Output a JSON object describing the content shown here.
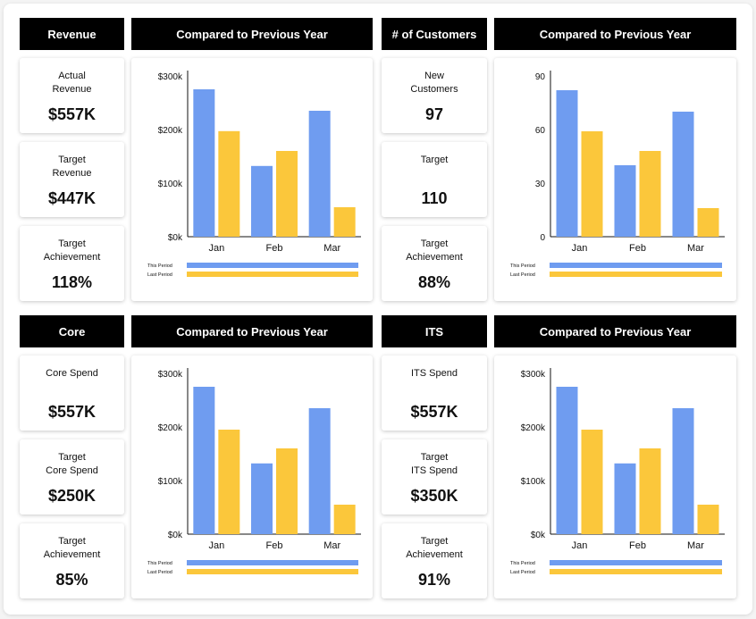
{
  "colors": {
    "this_period": "#6f9cf0",
    "last_period": "#fbc73b",
    "header_bg": "#000000"
  },
  "sections": [
    {
      "header": "Revenue",
      "chart_header": "Compared to Previous Year",
      "kpis": [
        {
          "label": "Actual\nRevenue",
          "value": "$557K"
        },
        {
          "label": "Target\nRevenue",
          "value": "$447K"
        },
        {
          "label": "Target\nAchievement",
          "value": "118%"
        }
      ]
    },
    {
      "header": "# of Customers",
      "chart_header": "Compared to Previous Year",
      "kpis": [
        {
          "label": "New\nCustomers",
          "value": "97"
        },
        {
          "label": "Target",
          "value": "110"
        },
        {
          "label": "Target\nAchievement",
          "value": "88%"
        }
      ]
    },
    {
      "header": "Core",
      "chart_header": "Compared to Previous Year",
      "kpis": [
        {
          "label": "Core Spend",
          "value": "$557K"
        },
        {
          "label": "Target\nCore Spend",
          "value": "$250K"
        },
        {
          "label": "Target\nAchievement",
          "value": "85%"
        }
      ]
    },
    {
      "header": "ITS",
      "chart_header": "Compared to Previous Year",
      "kpis": [
        {
          "label": "ITS Spend",
          "value": "$557K"
        },
        {
          "label": "Target\nITS Spend",
          "value": "$350K"
        },
        {
          "label": "Target\nAchievement",
          "value": "91%"
        }
      ]
    }
  ],
  "chart_data": [
    {
      "type": "bar",
      "categories": [
        "Jan",
        "Feb",
        "Mar"
      ],
      "series": [
        {
          "name": "This Period",
          "values": [
            275,
            132,
            235
          ]
        },
        {
          "name": "Last Period",
          "values": [
            197,
            160,
            55
          ]
        }
      ],
      "ylim": [
        0,
        300
      ],
      "ytick_values": [
        0,
        100,
        200,
        300
      ],
      "ytick_labels": [
        "$0k",
        "$100k",
        "$200k",
        "$300k"
      ]
    },
    {
      "type": "bar",
      "categories": [
        "Jan",
        "Feb",
        "Mar"
      ],
      "series": [
        {
          "name": "This Period",
          "values": [
            82,
            40,
            70
          ]
        },
        {
          "name": "Last Period",
          "values": [
            59,
            48,
            16
          ]
        }
      ],
      "ylim": [
        0,
        90
      ],
      "ytick_values": [
        0,
        30,
        60,
        90
      ],
      "ytick_labels": [
        "0",
        "30",
        "60",
        "90"
      ]
    },
    {
      "type": "bar",
      "categories": [
        "Jan",
        "Feb",
        "Mar"
      ],
      "series": [
        {
          "name": "This Period",
          "values": [
            275,
            132,
            235
          ]
        },
        {
          "name": "Last Period",
          "values": [
            195,
            160,
            55
          ]
        }
      ],
      "ylim": [
        0,
        300
      ],
      "ytick_values": [
        0,
        100,
        200,
        300
      ],
      "ytick_labels": [
        "$0k",
        "$100k",
        "$200k",
        "$300k"
      ]
    },
    {
      "type": "bar",
      "categories": [
        "Jan",
        "Feb",
        "Mar"
      ],
      "series": [
        {
          "name": "This Period",
          "values": [
            275,
            132,
            235
          ]
        },
        {
          "name": "Last Period",
          "values": [
            195,
            160,
            55
          ]
        }
      ],
      "ylim": [
        0,
        300
      ],
      "ytick_values": [
        0,
        100,
        200,
        300
      ],
      "ytick_labels": [
        "$0k",
        "$100k",
        "$200k",
        "$300k"
      ]
    }
  ]
}
